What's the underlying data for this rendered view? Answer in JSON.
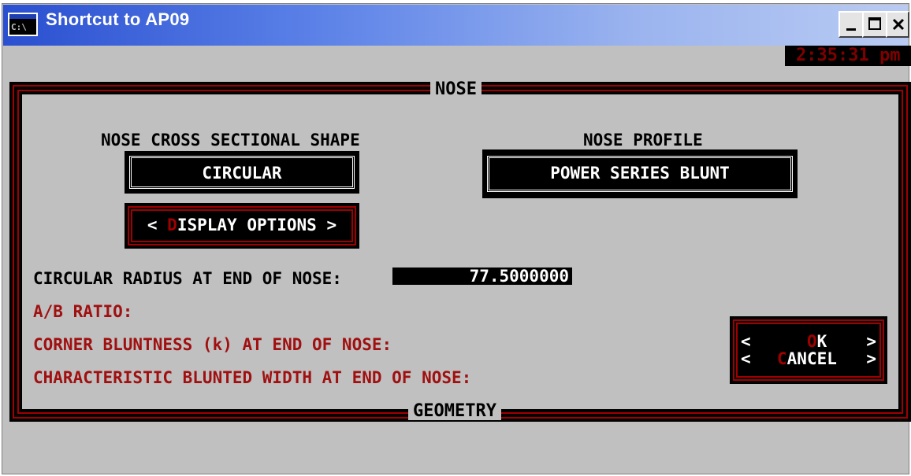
{
  "window": {
    "title": "Shortcut to AP09",
    "icon": "console-icon",
    "icon_text": "C:\\",
    "controls": [
      "minimize-icon",
      "maximize-icon",
      "close-icon"
    ]
  },
  "clock": "2:35:31 pm",
  "nose_frame": {
    "title": "NOSE",
    "bottom_title": "GEOMETRY"
  },
  "cross_section": {
    "label": "NOSE CROSS SECTIONAL SHAPE",
    "value": "CIRCULAR"
  },
  "profile": {
    "label": "NOSE PROFILE",
    "value": "POWER SERIES BLUNT"
  },
  "display_options": {
    "left": "<",
    "hotkey": "D",
    "rest": "ISPLAY OPTIONS",
    "right": ">"
  },
  "fields": {
    "radius_label": "CIRCULAR RADIUS AT END OF NOSE:",
    "radius_value": "77.5000000",
    "ab_label": "A/B RATIO:",
    "corner_label": "CORNER BLUNTNESS (k) AT END OF NOSE:",
    "width_label": "CHARACTERISTIC BLUNTED WIDTH AT END OF NOSE:"
  },
  "actions": {
    "ok_hotkey": "O",
    "ok_rest": "K",
    "cancel_hotkey": "C",
    "cancel_rest": "ANCEL",
    "left": "<",
    "right": ">"
  },
  "colors": {
    "accent_red": "#a00000",
    "dialog_gray": "#c0c0c0"
  }
}
